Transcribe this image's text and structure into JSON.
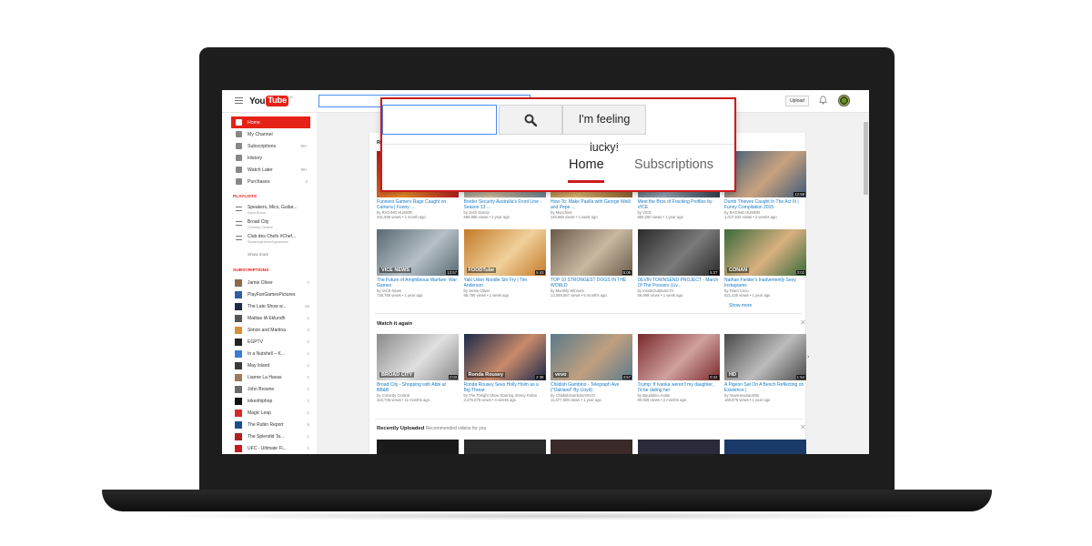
{
  "header": {
    "logo_you": "You",
    "logo_tube": "Tube",
    "logo_country": "IN",
    "upload_label": "Upload",
    "icons": [
      "hamburger-menu-icon",
      "bell-icon",
      "avatar"
    ]
  },
  "popup": {
    "lucky_label": "I'm feeling lucky!",
    "tabs": [
      {
        "label": "Home",
        "active": true
      },
      {
        "label": "Subscriptions",
        "active": false
      }
    ],
    "accent_color": "#cc1b1b"
  },
  "sidebar": {
    "nav": [
      {
        "label": "Home",
        "icon": "home-icon",
        "active": true,
        "count": ""
      },
      {
        "label": "My Channel",
        "icon": "user-icon",
        "count": ""
      },
      {
        "label": "Subscriptions",
        "icon": "subscriptions-icon",
        "count": "99+"
      },
      {
        "label": "History",
        "icon": "hourglass-icon",
        "count": ""
      },
      {
        "label": "Watch Later",
        "icon": "clock-icon",
        "count": "99+"
      },
      {
        "label": "Purchases",
        "icon": "purchases-icon",
        "count": "4"
      }
    ],
    "playlists_heading": "PLAYLISTS",
    "playlists": [
      {
        "label": "Speakers, Mics, Guitar...",
        "sub": "Ryan Bruce"
      },
      {
        "label": "Broad City",
        "sub": "Comedy Central"
      },
      {
        "label": "Club des Chefs #Chef...",
        "sub": "SamsungHomeAppliances"
      }
    ],
    "playlists_show_more": "Show more",
    "subscriptions_heading": "SUBSCRIPTIONS",
    "subscriptions": [
      {
        "label": "Jamie Oliver",
        "count": "7",
        "color": "#8a6a4a"
      },
      {
        "label": "PlayFunGamesPictures",
        "count": "",
        "color": "#2f5da8"
      },
      {
        "label": "The Late Show w...",
        "count": "26",
        "color": "#1f2a44"
      },
      {
        "label": "Mattias IA Eklundh",
        "count": "1",
        "color": "#555555"
      },
      {
        "label": "Simon and Martina",
        "count": "2",
        "color": "#d98e3a"
      },
      {
        "label": "EGPTV",
        "count": "1",
        "color": "#222222"
      },
      {
        "label": "In a Nutshell – K...",
        "count": "1",
        "color": "#3a7bd5"
      },
      {
        "label": "May Island",
        "count": "1",
        "color": "#3b3b3b"
      },
      {
        "label": "Lianne La Havas",
        "count": "1",
        "color": "#9a7b5b"
      },
      {
        "label": "John Browne",
        "count": "1",
        "color": "#6a6a6a"
      },
      {
        "label": "tokenhiphop",
        "count": "1",
        "color": "#111111"
      },
      {
        "label": "Magic Leap",
        "count": "1",
        "color": "#d62a2a"
      },
      {
        "label": "The Rubin Report",
        "count": "8",
        "color": "#1b4f8a"
      },
      {
        "label": "The Splendid Ta...",
        "count": "1",
        "color": "#b01f1f"
      },
      {
        "label": "UFC - Ultimate Fi...",
        "count": "1",
        "color": "#c21d1d"
      }
    ]
  },
  "sections": {
    "recommended": {
      "title_initial": "R",
      "show_more": "Show more",
      "row1": [
        {
          "title": "Funniest Gamers Rage Caught on Camera | Funny ...",
          "channel": "by RAGING HUMOR",
          "meta": "341,695 views • 1 month ago",
          "duration": "",
          "colors": [
            "#b31b1b",
            "#e88a2a"
          ]
        },
        {
          "title": "Border Security Australia's Front Line - Season 13 ...",
          "channel": "by Josh Garcia",
          "meta": "569,995 views • 1 year ago",
          "duration": "",
          "colors": [
            "#6a7d8c",
            "#c7b79a"
          ]
        },
        {
          "title": "How-To: Make Paella with George Weill and Pepe ...",
          "channel": "by Munchies",
          "meta": "119,655 views • 1 week ago",
          "duration": "",
          "colors": [
            "#8a5a2b",
            "#d9b06a"
          ]
        },
        {
          "title": "Meet the Bros of Fracking Profiles by VICE",
          "channel": "by VICE",
          "meta": "892,250 views • 1 year ago",
          "duration": "",
          "colors": [
            "#2e3b4a",
            "#93a2b0"
          ]
        },
        {
          "title": "Dumb Thieves Caught In The Act III | Funny Compilation 2015",
          "channel": "by RAGING HUMOR",
          "meta": "1,017,632 views • 2 weeks ago",
          "duration": "12:58",
          "colors": [
            "#3e5a7a",
            "#c9a27e"
          ]
        }
      ],
      "row2": [
        {
          "title": "The Future of Amphibious Warfare: War Games",
          "channel": "by VICE News",
          "meta": "728,769 views • 1 year ago",
          "duration": "13:57",
          "overlay": "VICE NEWS",
          "colors": [
            "#5a6a73",
            "#b5c0c6"
          ]
        },
        {
          "title": "Yaki Udon Noodle Stir Fry | Tim Anderson",
          "channel": "by Jamie Oliver",
          "meta": "88,790 views • 1 week ago",
          "duration": "5:43",
          "overlay": "FOODTube",
          "colors": [
            "#c47a2a",
            "#f0d09a"
          ]
        },
        {
          "title": "TOP 10 STRONGEST DOGS IN THE WORLD",
          "channel": "by Monthly Winners",
          "meta": "13,089,697 views • 5 months ago",
          "duration": "5:06",
          "colors": [
            "#6b5a4a",
            "#c8b8a0"
          ]
        },
        {
          "title": "DEVIN TOWNSEND PROJECT - March Of The Poozers (Liv...",
          "channel": "by InsideOutMusicTV",
          "meta": "59,999 views • 1 week ago",
          "duration": "5:27",
          "colors": [
            "#2a2a2a",
            "#7a7a7a"
          ]
        },
        {
          "title": "Nathan Fielder's Inadvertently Sexy Instagrams",
          "channel": "by Team Coco",
          "meta": "521,425 views • 1 year ago",
          "duration": "3:02",
          "overlay": "CONAN",
          "colors": [
            "#3a6a3a",
            "#d8b080"
          ]
        }
      ]
    },
    "watch_again": {
      "title": "Watch it again",
      "videos": [
        {
          "title": "Broad City - Shopping with Abbi at BB&B",
          "channel": "by Comedy Central",
          "meta": "322,706 views • 11 months ago",
          "duration": "2:03",
          "overlay": "BROAD CITY",
          "colors": [
            "#8a8a8a",
            "#e0e0e0"
          ]
        },
        {
          "title": "Ronda Rousey Sees Holly Holm as a Big Threat",
          "channel": "by The Tonight Show Starring Jimmy Fallon",
          "meta": "2,475,679 views • 4 weeks ago",
          "duration": "2:36",
          "overlay": "Ronda Rousey",
          "colors": [
            "#1a2a4a",
            "#c98a6a"
          ]
        },
        {
          "title": "Childish Gambino - Telegraph Ave (\"Oakland\" By Lloyd)",
          "channel": "by ChildishGambinoVEVO",
          "meta": "11,677,906 views • 1 year ago",
          "duration": "4:57",
          "overlay": "vevo",
          "colors": [
            "#5a7a8a",
            "#c0a080"
          ]
        },
        {
          "title": "Trump: If Ivanka weren't my daughter, I'd be dating her",
          "channel": "by Baudolino Aulan",
          "meta": "80,928 views • 2 months ago",
          "duration": "0:22",
          "colors": [
            "#7a2a2a",
            "#d0a0a0"
          ]
        },
        {
          "title": "A Pigeon Sat On A Bench Reflecting on Existence |",
          "channel": "by moviemaniacsDE",
          "meta": "169,876 views • 1 year ago",
          "duration": "1:54",
          "overlay": "HD",
          "colors": [
            "#4a4a4a",
            "#bcbcbc"
          ]
        }
      ]
    },
    "recently_uploaded": {
      "title": "Recently Uploaded",
      "subtitle": "Recommended videos for you",
      "colors": [
        "#1a1a1a",
        "#2a2a2a",
        "#3a2a2a",
        "#2a2a3a",
        "#1a3a6a"
      ]
    }
  }
}
